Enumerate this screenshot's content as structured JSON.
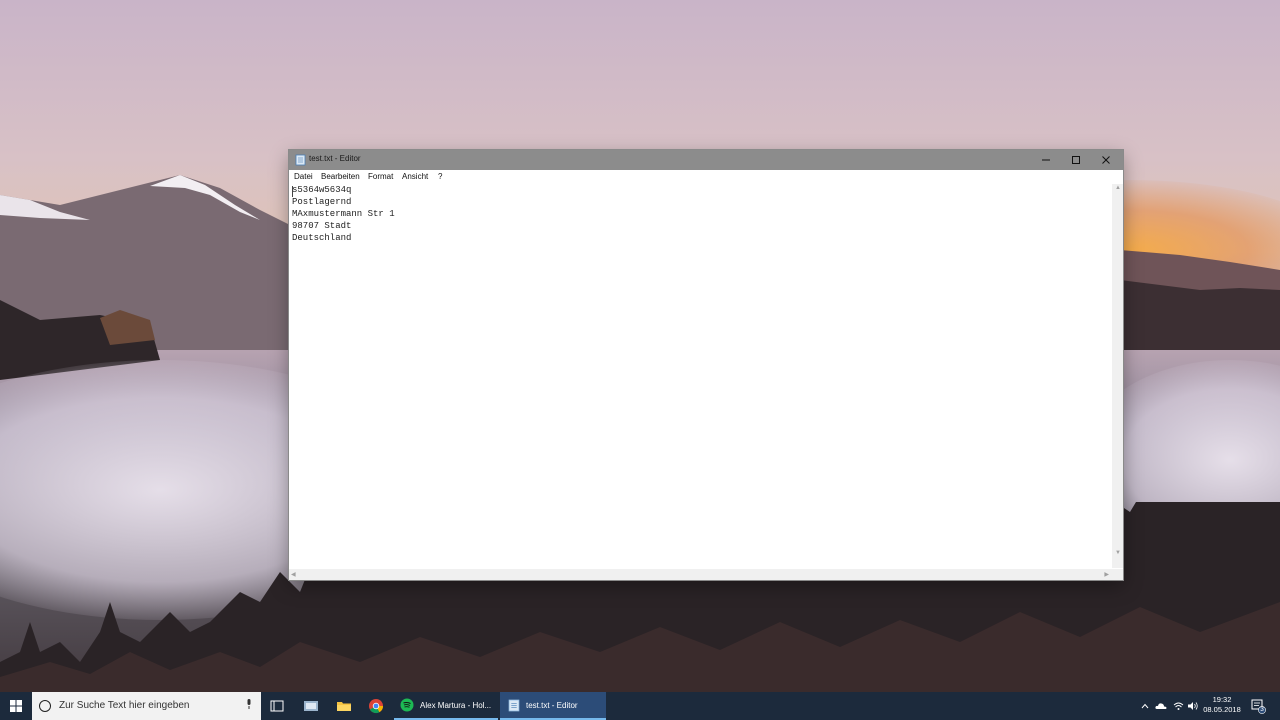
{
  "window": {
    "title": "test.txt - Editor",
    "menu": [
      "Datei",
      "Bearbeiten",
      "Format",
      "Ansicht",
      "?"
    ],
    "content_lines": [
      "s5364w5634q",
      "Postlagernd",
      "MAxmustermann Str 1",
      "98707 Stadt",
      "Deutschland"
    ]
  },
  "taskbar": {
    "search_placeholder": "Zur Suche Text hier eingeben",
    "pinned_icons": [
      "task-view-icon",
      "file-explorer-icon",
      "folder-icon",
      "chrome-icon"
    ],
    "tasks": [
      {
        "label": "Alex Martura - Hol...",
        "icon": "spotify-icon"
      },
      {
        "label": "test.txt - Editor",
        "icon": "notepad-icon"
      }
    ],
    "clock_time": "19:32",
    "clock_date": "08.05.2018",
    "notification_count": "3"
  },
  "colors": {
    "taskbar_bg": "#1c2a3c",
    "titlebar_bg": "#8c8c8c",
    "active_task_bg": "#2c4c78",
    "accent": "#76b9ed"
  }
}
